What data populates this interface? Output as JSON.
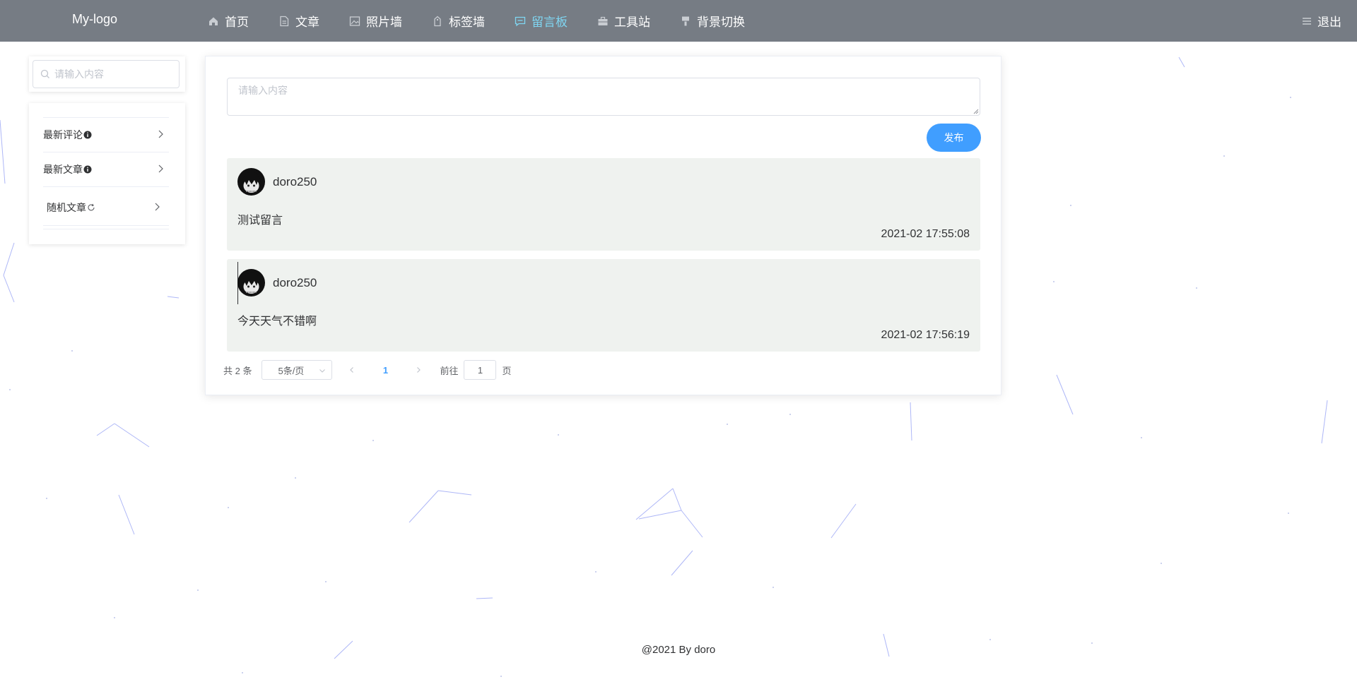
{
  "colors": {
    "topbar": "#767c84",
    "accent": "#409eff",
    "active_nav": "#7fd6f2",
    "comment_bg": "#eff2ef"
  },
  "header": {
    "logo": "My-logo",
    "nav": [
      {
        "label": "首页",
        "icon": "home-icon"
      },
      {
        "label": "文章",
        "icon": "document-icon"
      },
      {
        "label": "照片墙",
        "icon": "picture-icon"
      },
      {
        "label": "标签墙",
        "icon": "tag-icon"
      },
      {
        "label": "留言板",
        "icon": "chat-icon",
        "active": true
      },
      {
        "label": "工具站",
        "icon": "briefcase-icon"
      },
      {
        "label": "背景切换",
        "icon": "brush-icon"
      }
    ],
    "logout": {
      "label": "退出",
      "icon": "menu-lines-icon"
    }
  },
  "sidebar": {
    "search": {
      "placeholder": "请输入内容",
      "icon": "search-icon"
    },
    "items": [
      {
        "label": "最新评论",
        "icon": "info-icon"
      },
      {
        "label": "最新文章",
        "icon": "info-icon"
      },
      {
        "label": "随机文章",
        "icon": "refresh-icon"
      }
    ]
  },
  "board": {
    "input_placeholder": "请输入内容",
    "publish_label": "发布",
    "comments": [
      {
        "user": "doro250",
        "content": "测试留言",
        "time": "2021-02 17:55:08"
      },
      {
        "user": "doro250",
        "content": "今天天气不错啊",
        "time": "2021-02 17:56:19"
      }
    ],
    "pagination": {
      "total": "共 2 条",
      "page_size": "5条/页",
      "current_page": "1",
      "goto_label": "前往",
      "goto_value": "1",
      "page_suffix": "页"
    }
  },
  "footer": "@2021 By doro"
}
